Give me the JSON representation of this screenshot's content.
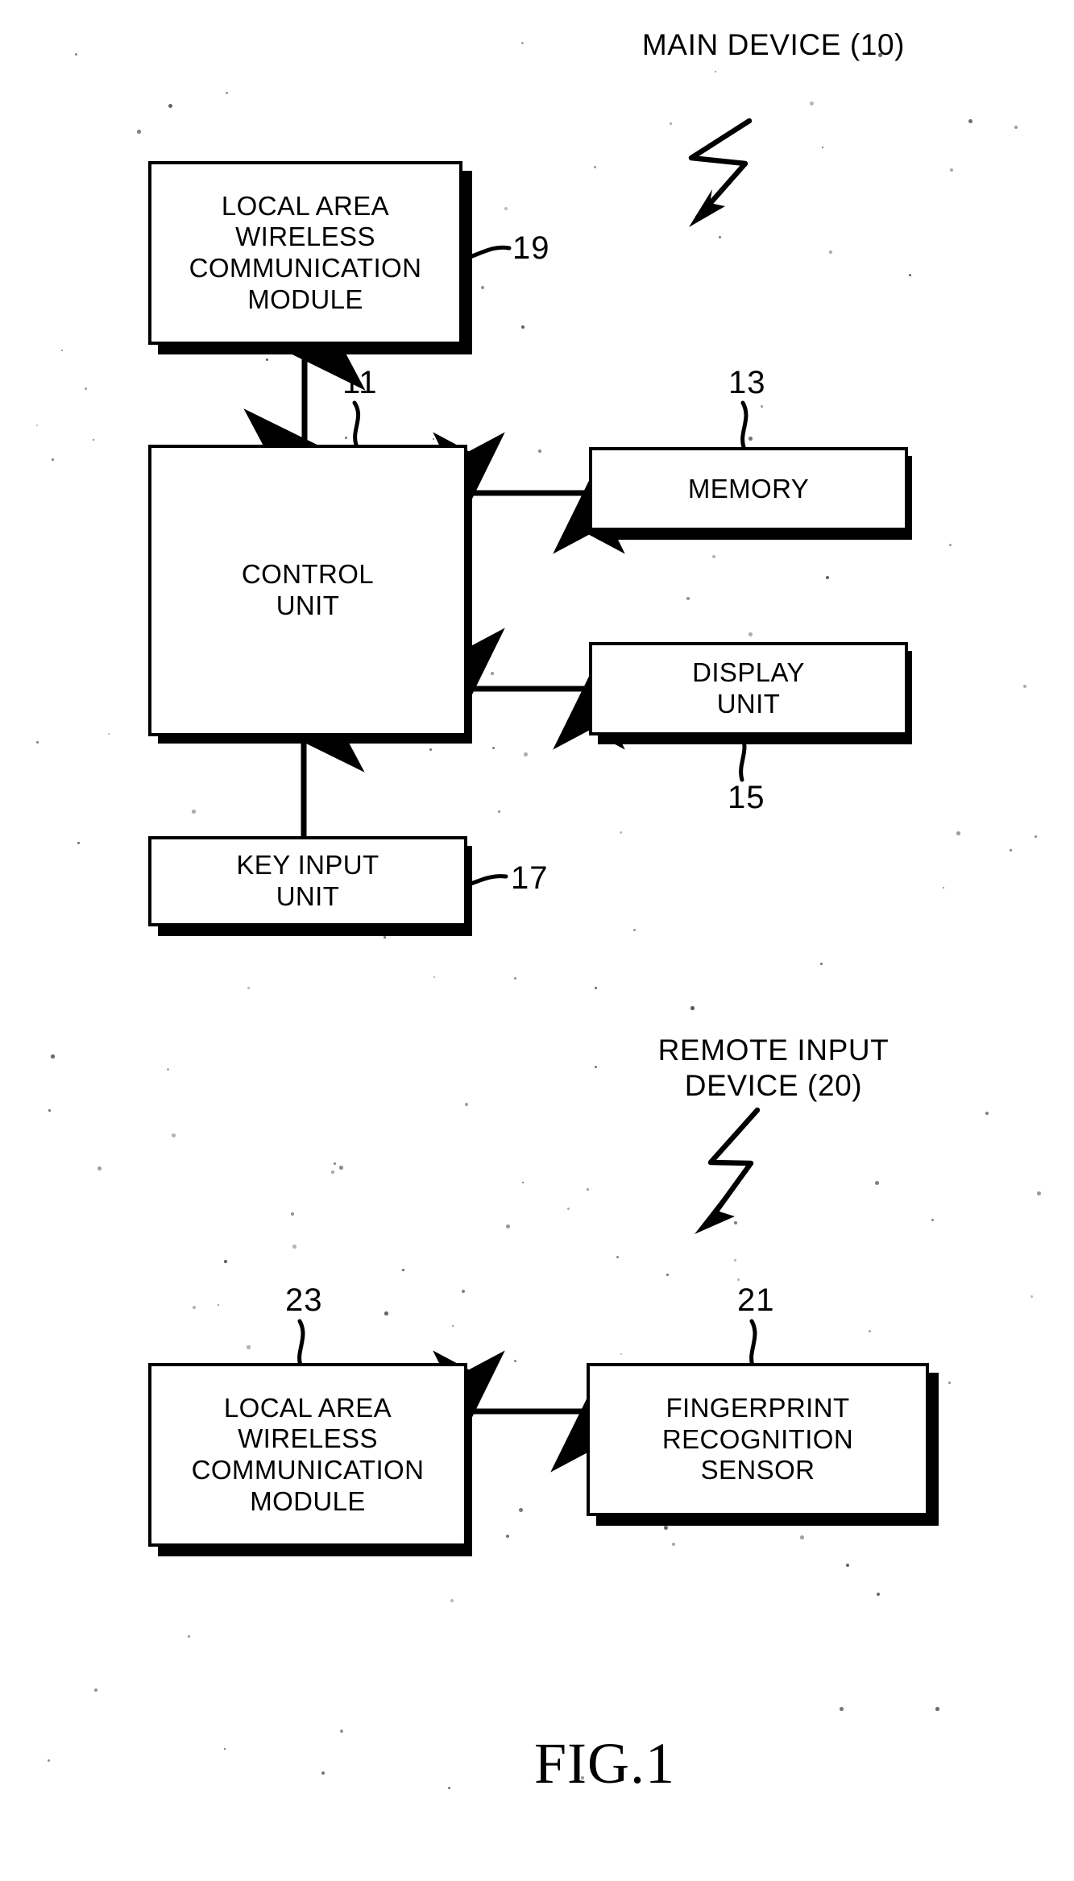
{
  "figure": {
    "caption": "FIG.1",
    "groups": [
      {
        "name": "main-device",
        "label": "MAIN DEVICE (10)"
      },
      {
        "name": "remote-input-device",
        "label": "REMOTE INPUT\nDEVICE (20)"
      }
    ],
    "blocks": [
      {
        "name": "local-area-wireless-communication-module-19",
        "label": "LOCAL AREA\nWIRELESS\nCOMMUNICATION\nMODULE",
        "ref": "19"
      },
      {
        "name": "control-unit",
        "label": "CONTROL\nUNIT",
        "ref": "11"
      },
      {
        "name": "memory",
        "label": "MEMORY",
        "ref": "13"
      },
      {
        "name": "display-unit",
        "label": "DISPLAY\nUNIT",
        "ref": "15"
      },
      {
        "name": "key-input-unit",
        "label": "KEY INPUT\nUNIT",
        "ref": "17"
      },
      {
        "name": "local-area-wireless-communication-module-23",
        "label": "LOCAL AREA\nWIRELESS\nCOMMUNICATION\nMODULE",
        "ref": "23"
      },
      {
        "name": "fingerprint-recognition-sensor",
        "label": "FINGERPRINT\nRECOGNITION\nSENSOR",
        "ref": "21"
      }
    ],
    "connectors": [
      {
        "name": "lawcm19-to-control-unit",
        "kind": "double-arrow-vertical"
      },
      {
        "name": "control-unit-to-memory",
        "kind": "double-arrow-horizontal"
      },
      {
        "name": "control-unit-to-display-unit",
        "kind": "double-arrow-horizontal"
      },
      {
        "name": "key-input-unit-to-control-unit",
        "kind": "single-arrow-up"
      },
      {
        "name": "lawcm23-to-fingerprint-sensor",
        "kind": "double-arrow-horizontal"
      }
    ],
    "colors": {
      "ink": "#000000",
      "paper": "#ffffff"
    }
  }
}
